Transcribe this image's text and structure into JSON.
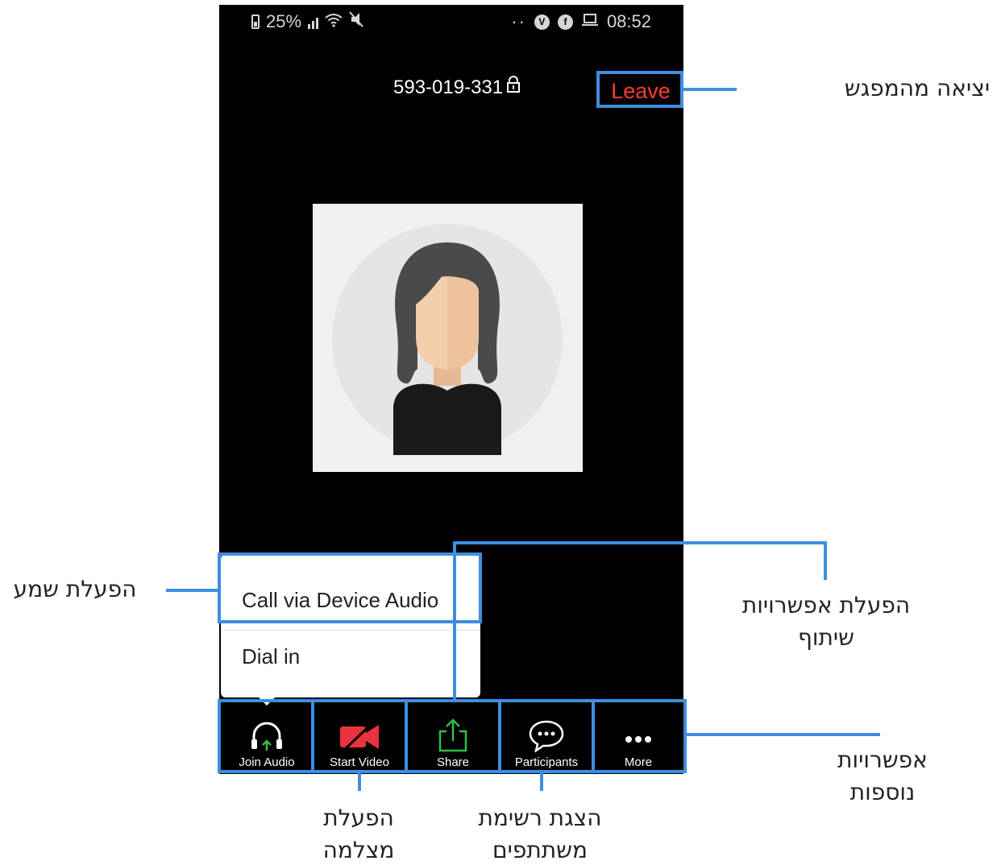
{
  "status_bar": {
    "battery": "25%",
    "dots": "··",
    "time": "08:52"
  },
  "header": {
    "meeting_id": "593-019-331",
    "leave_label": "Leave"
  },
  "audio_menu": {
    "items": [
      "Call via Device Audio",
      "Dial in"
    ]
  },
  "toolbar": {
    "buttons": [
      {
        "label": "Join Audio",
        "icon": "headphones-icon"
      },
      {
        "label": "Start Video",
        "icon": "video-off-icon"
      },
      {
        "label": "Share",
        "icon": "share-icon"
      },
      {
        "label": "Participants",
        "icon": "chat-bubble-icon"
      },
      {
        "label": "More",
        "icon": "more-icon"
      }
    ]
  },
  "callouts": {
    "leave": "יציאה מהמפגש",
    "audio": "הפעלת שמע",
    "share_line1": "הפעלת אפשרויות",
    "share_line2": "שיתוף",
    "more_line1": "אפשרויות",
    "more_line2": "נוספות",
    "video_line1": "הפעלת",
    "video_line2": "מצלמה",
    "participants_line1": "הצגת רשימת",
    "participants_line2": "משתתפים"
  },
  "colors": {
    "highlight": "#3f8de0",
    "leave": "#ff3b30",
    "video_off": "#e8323c",
    "share_green": "#2fbf4a",
    "audio_arrow": "#2fbf4a"
  }
}
